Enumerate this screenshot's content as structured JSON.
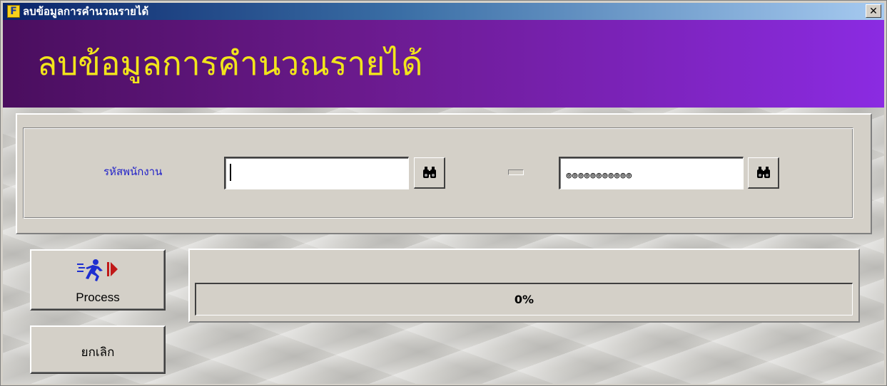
{
  "window": {
    "title": "ลบข้อมูลการคำนวณรายได้",
    "app_icon_letter": "F",
    "close_symbol": "✕"
  },
  "header": {
    "title": "ลบข้อมูลการคำนวณรายได้"
  },
  "criteria": {
    "employee_code_label": "รหัสพนักงาน",
    "from_value": "",
    "to_value": "⊚⊚⊚⊚⊚⊚⊚⊚⊚⊚⊚",
    "find_icon": "binoculars-icon"
  },
  "actions": {
    "process_label": "Process",
    "process_icon": "running-man-icon",
    "cancel_label": "ยกเลิก"
  },
  "progress": {
    "percent": 0,
    "text": "0%"
  },
  "colors": {
    "banner_text": "#f2e51b",
    "banner_bg_start": "#4a0e5e",
    "banner_bg_end": "#8b2be2",
    "label_blue": "#1f1fc8"
  }
}
